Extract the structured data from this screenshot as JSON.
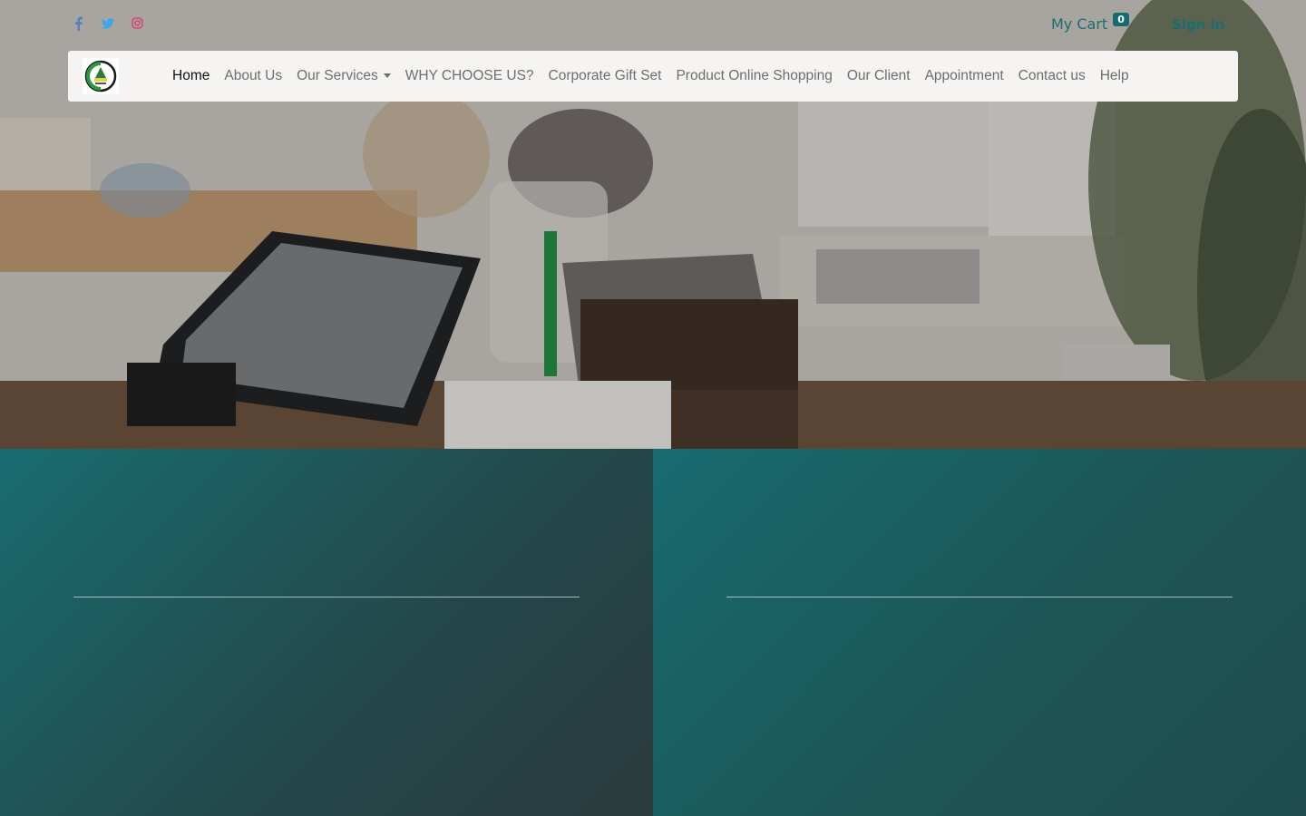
{
  "topbar": {
    "social_icons": [
      "facebook-icon",
      "twitter-icon",
      "instagram-icon"
    ],
    "cart_label": "My Cart",
    "cart_count": "0",
    "signin_label": "Sign in"
  },
  "navbar": {
    "logo": "company-logo",
    "items": [
      {
        "label": "Home",
        "active": true
      },
      {
        "label": "About Us"
      },
      {
        "label": "Our Services",
        "dropdown": true
      },
      {
        "label": "WHY CHOOSE US?"
      },
      {
        "label": "Corporate Gift Set"
      },
      {
        "label": "Product Online Shopping"
      },
      {
        "label": "Our Client"
      },
      {
        "label": "Appointment"
      },
      {
        "label": "Contact us"
      },
      {
        "label": "Help"
      }
    ]
  },
  "colors": {
    "accent": "#156c70",
    "facebook": "#5a7fc0",
    "twitter": "#3ea6e8",
    "instagram": "#d6417a",
    "navbar_bg": "#f5f4f2"
  }
}
